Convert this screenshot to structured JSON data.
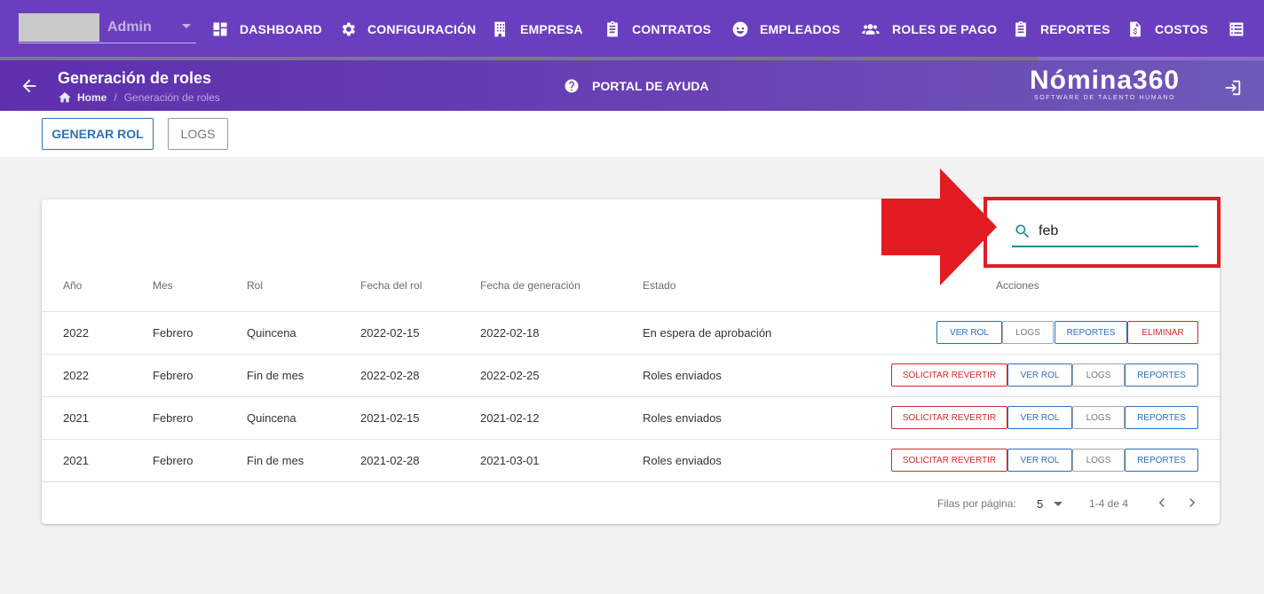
{
  "user": {
    "name": "Admin"
  },
  "nav": {
    "items": [
      {
        "label": "DASHBOARD",
        "icon": "dashboard-icon"
      },
      {
        "label": "CONFIGURACIÓN",
        "icon": "gear-icon"
      },
      {
        "label": "EMPRESA",
        "icon": "building-icon"
      },
      {
        "label": "CONTRATOS",
        "icon": "clipboard-icon"
      },
      {
        "label": "EMPLEADOS",
        "icon": "face-icon"
      },
      {
        "label": "ROLES DE PAGO",
        "icon": "group-icon"
      },
      {
        "label": "REPORTES",
        "icon": "clipboard-list-icon"
      },
      {
        "label": "COSTOS",
        "icon": "invoice-icon"
      }
    ],
    "more_icon": "list-icon"
  },
  "header": {
    "title": "Generación de roles",
    "breadcrumb": {
      "home": "Home",
      "separator": "/",
      "current": "Generación de roles"
    },
    "help_label": "PORTAL DE AYUDA",
    "brand": {
      "name": "Nómina360",
      "tagline": "SOFTWARE DE TALENTO HUMANO"
    }
  },
  "actions": {
    "generar_label": "GENERAR ROL",
    "logs_label": "LOGS"
  },
  "search": {
    "value": "feb",
    "icon": "search-icon"
  },
  "table": {
    "headers": {
      "anio": "Año",
      "mes": "Mes",
      "rol": "Rol",
      "fecha_rol": "Fecha del rol",
      "fecha_gen": "Fecha de generación",
      "estado": "Estado",
      "acciones": "Acciones"
    },
    "rows": [
      {
        "anio": "2022",
        "mes": "Febrero",
        "rol": "Quincena",
        "fecha_rol": "2022-02-15",
        "fecha_gen": "2022-02-18",
        "estado": "En espera de aprobación",
        "buttons": [
          "VER ROL",
          "LOGS",
          "REPORTES",
          "ELIMINAR"
        ]
      },
      {
        "anio": "2022",
        "mes": "Febrero",
        "rol": "Fin de mes",
        "fecha_rol": "2022-02-28",
        "fecha_gen": "2022-02-25",
        "estado": "Roles enviados",
        "buttons": [
          "SOLICITAR REVERTIR",
          "VER ROL",
          "LOGS",
          "REPORTES"
        ]
      },
      {
        "anio": "2021",
        "mes": "Febrero",
        "rol": "Quincena",
        "fecha_rol": "2021-02-15",
        "fecha_gen": "2021-02-12",
        "estado": "Roles enviados",
        "buttons": [
          "SOLICITAR REVERTIR",
          "VER ROL",
          "LOGS",
          "REPORTES"
        ]
      },
      {
        "anio": "2021",
        "mes": "Febrero",
        "rol": "Fin de mes",
        "fecha_rol": "2021-02-28",
        "fecha_gen": "2021-03-01",
        "estado": "Roles enviados",
        "buttons": [
          "SOLICITAR REVERTIR",
          "VER ROL",
          "LOGS",
          "REPORTES"
        ]
      }
    ]
  },
  "pagination": {
    "rows_label": "Filas por página:",
    "rows_per_page": "5",
    "range": "1-4 de 4"
  },
  "colors": {
    "primary": "#6a3fbf",
    "accent_blue": "#2f73b8",
    "danger": "#cc2b2b",
    "search_teal": "#1a8b94",
    "callout_red": "#e31b23"
  }
}
